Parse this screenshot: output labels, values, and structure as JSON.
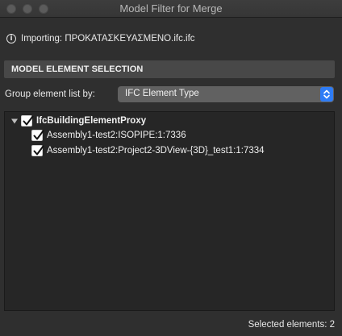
{
  "window": {
    "title": "Model Filter for Merge"
  },
  "info": {
    "icon": "info-icon",
    "glyph": "i",
    "text": "Importing: ΠΡΟΚΑΤΑΣΚΕΥΑΣΜΕΝΟ.ifc.ifc"
  },
  "section": {
    "title": "MODEL ELEMENT SELECTION"
  },
  "group": {
    "label": "Group element list by:",
    "selected": "IFC Element Type"
  },
  "tree": {
    "parent": {
      "label": "IfcBuildingElementProxy",
      "checked": true,
      "expanded": true
    },
    "children": [
      {
        "label": "Assembly1-test2:ISOPIPE:1:7336",
        "checked": true
      },
      {
        "label": "Assembly1-test2:Project2-3DView-{3D}_test1:1:7334",
        "checked": true
      }
    ]
  },
  "footer": {
    "selected_text": "Selected elements: 2"
  },
  "colors": {
    "accent": "#2e7cf6",
    "background": "#2f2f2f",
    "tree_background": "#262626",
    "section_header": "#484848"
  }
}
